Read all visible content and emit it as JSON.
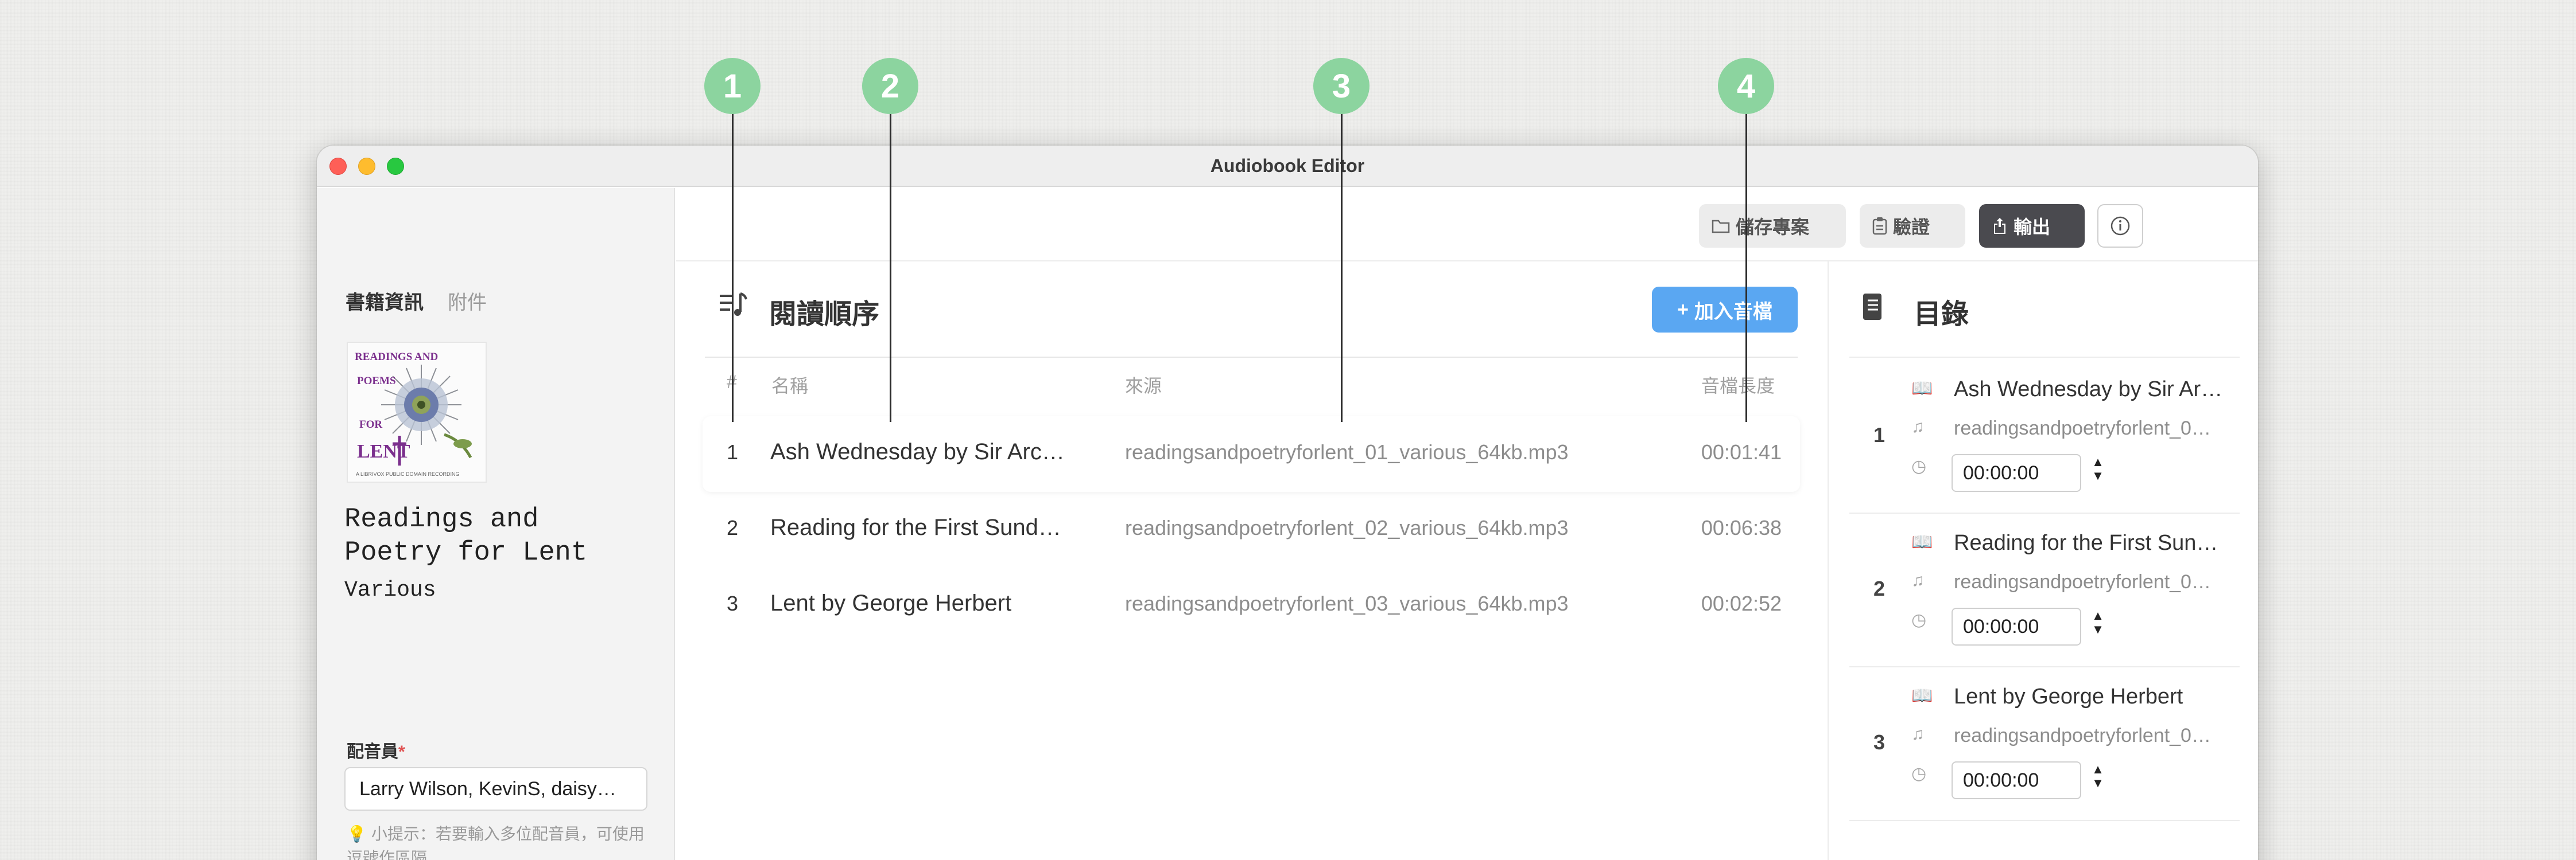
{
  "window": {
    "title": "Audiobook Editor"
  },
  "sidebar": {
    "tabs": [
      "書籍資訊",
      "附件"
    ],
    "book_title": "Readings and Poetry for Lent",
    "book_author": "Various",
    "cover": {
      "lines": [
        "READINGS AND",
        "POEMS",
        "FOR",
        "LENT",
        "A LIBRIVOX PUBLIC DOMAIN RECORDING"
      ]
    },
    "narrator_label": "配音員",
    "narrator_required": "*",
    "narrator_value": "Larry Wilson, KevinS, daisy…",
    "hint_icon": "💡",
    "hint_text": "小提示：若要輸入多位配音員，可使用逗號作區隔"
  },
  "toolbar": {
    "save_label": "儲存專案",
    "verify_label": "驗證",
    "export_label": "輸出",
    "info_icon": "info-icon"
  },
  "reading_order": {
    "title": "閱讀順序",
    "add_button": "加入音檔",
    "add_prefix": "+",
    "columns": {
      "num": "#",
      "name": "名稱",
      "source": "來源",
      "duration": "音檔長度"
    },
    "rows": [
      {
        "num": "1",
        "name": "Ash Wednesday by Sir Arc…",
        "source": "readingsandpoetryforlent_01_various_64kb.mp3",
        "duration": "00:01:41"
      },
      {
        "num": "2",
        "name": "Reading for the First Sund…",
        "source": "readingsandpoetryforlent_02_various_64kb.mp3",
        "duration": "00:06:38"
      },
      {
        "num": "3",
        "name": "Lent by George Herbert",
        "source": "readingsandpoetryforlent_03_various_64kb.mp3",
        "duration": "00:02:52"
      }
    ]
  },
  "toc": {
    "title": "目錄",
    "items": [
      {
        "num": "1",
        "name": "Ash Wednesday by Sir Ar…",
        "source": "readingsandpoetryforlent_0…",
        "time": "00:00:00"
      },
      {
        "num": "2",
        "name": "Reading for the First Sun…",
        "source": "readingsandpoetryforlent_0…",
        "time": "00:00:00"
      },
      {
        "num": "3",
        "name": "Lent by George Herbert",
        "source": "readingsandpoetryforlent_0…",
        "time": "00:00:00"
      }
    ]
  },
  "callouts": [
    "1",
    "2",
    "3",
    "4"
  ],
  "colors": {
    "accent_blue": "#5aa7f2",
    "callout_green": "#8cd49f",
    "export_dark": "#4a4a4f",
    "book_icon_purple": "#b17ae8"
  }
}
